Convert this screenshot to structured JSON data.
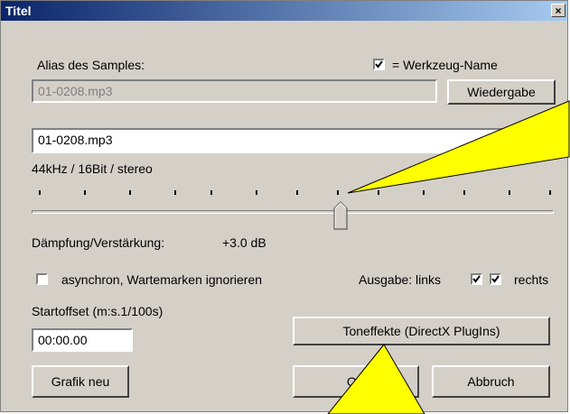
{
  "window": {
    "title": "Titel",
    "close_glyph": "×"
  },
  "alias_label": "Alias des Samples:",
  "tool_name": {
    "checked": true,
    "label": "= Werkzeug-Name"
  },
  "alias_field_value": "01-0208.mp3",
  "play_button": "Wiedergabe",
  "file_field_value": "01-0208.mp3",
  "audio_format": "44kHz / 16Bit / stereo",
  "slider": {
    "level_fraction": 0.592
  },
  "gain_label": "Dämpfung/Verstärkung:",
  "gain_value": "+3.0 dB",
  "async_option": {
    "checked": false,
    "label": "asynchron, Wartemarken ignorieren"
  },
  "output": {
    "label": "Ausgabe: links",
    "left_checked": true,
    "right_checked": true,
    "right_label": "rechts"
  },
  "start_offset": {
    "label": "Startoffset (m:s.1/100s)",
    "value": "00:00.00"
  },
  "effects_button": "Toneffekte (DirectX PlugIns)",
  "redraw_button": "Grafik neu",
  "ok_button": "OK",
  "cancel_button": "Abbruch",
  "callout_color": "#ffff00",
  "icons": [
    "close-icon",
    "checkbox-icon",
    "slider-thumb-icon",
    "callout-arrow-icon"
  ]
}
